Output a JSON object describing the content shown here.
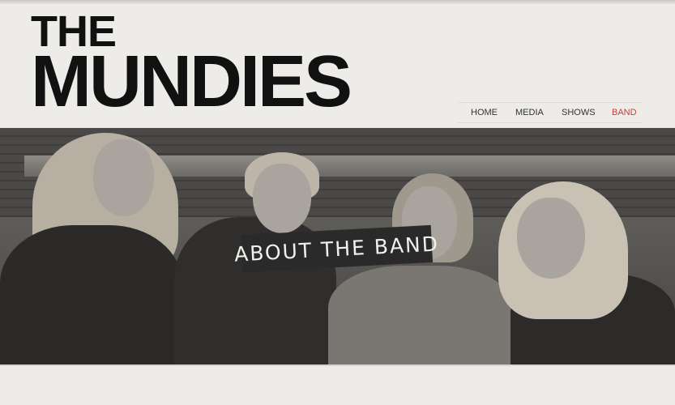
{
  "logo": {
    "line1": "THE",
    "line2": "MUNDIES"
  },
  "nav": {
    "items": [
      {
        "label": "HOME",
        "active": false
      },
      {
        "label": "MEDIA",
        "active": false
      },
      {
        "label": "SHOWS",
        "active": false
      },
      {
        "label": "BAND",
        "active": true
      }
    ]
  },
  "hero": {
    "banner_text": "ABOUT THE BAND"
  },
  "colors": {
    "accent": "#c2403a",
    "background": "#eeece8",
    "banner": "#2a2a2a"
  }
}
